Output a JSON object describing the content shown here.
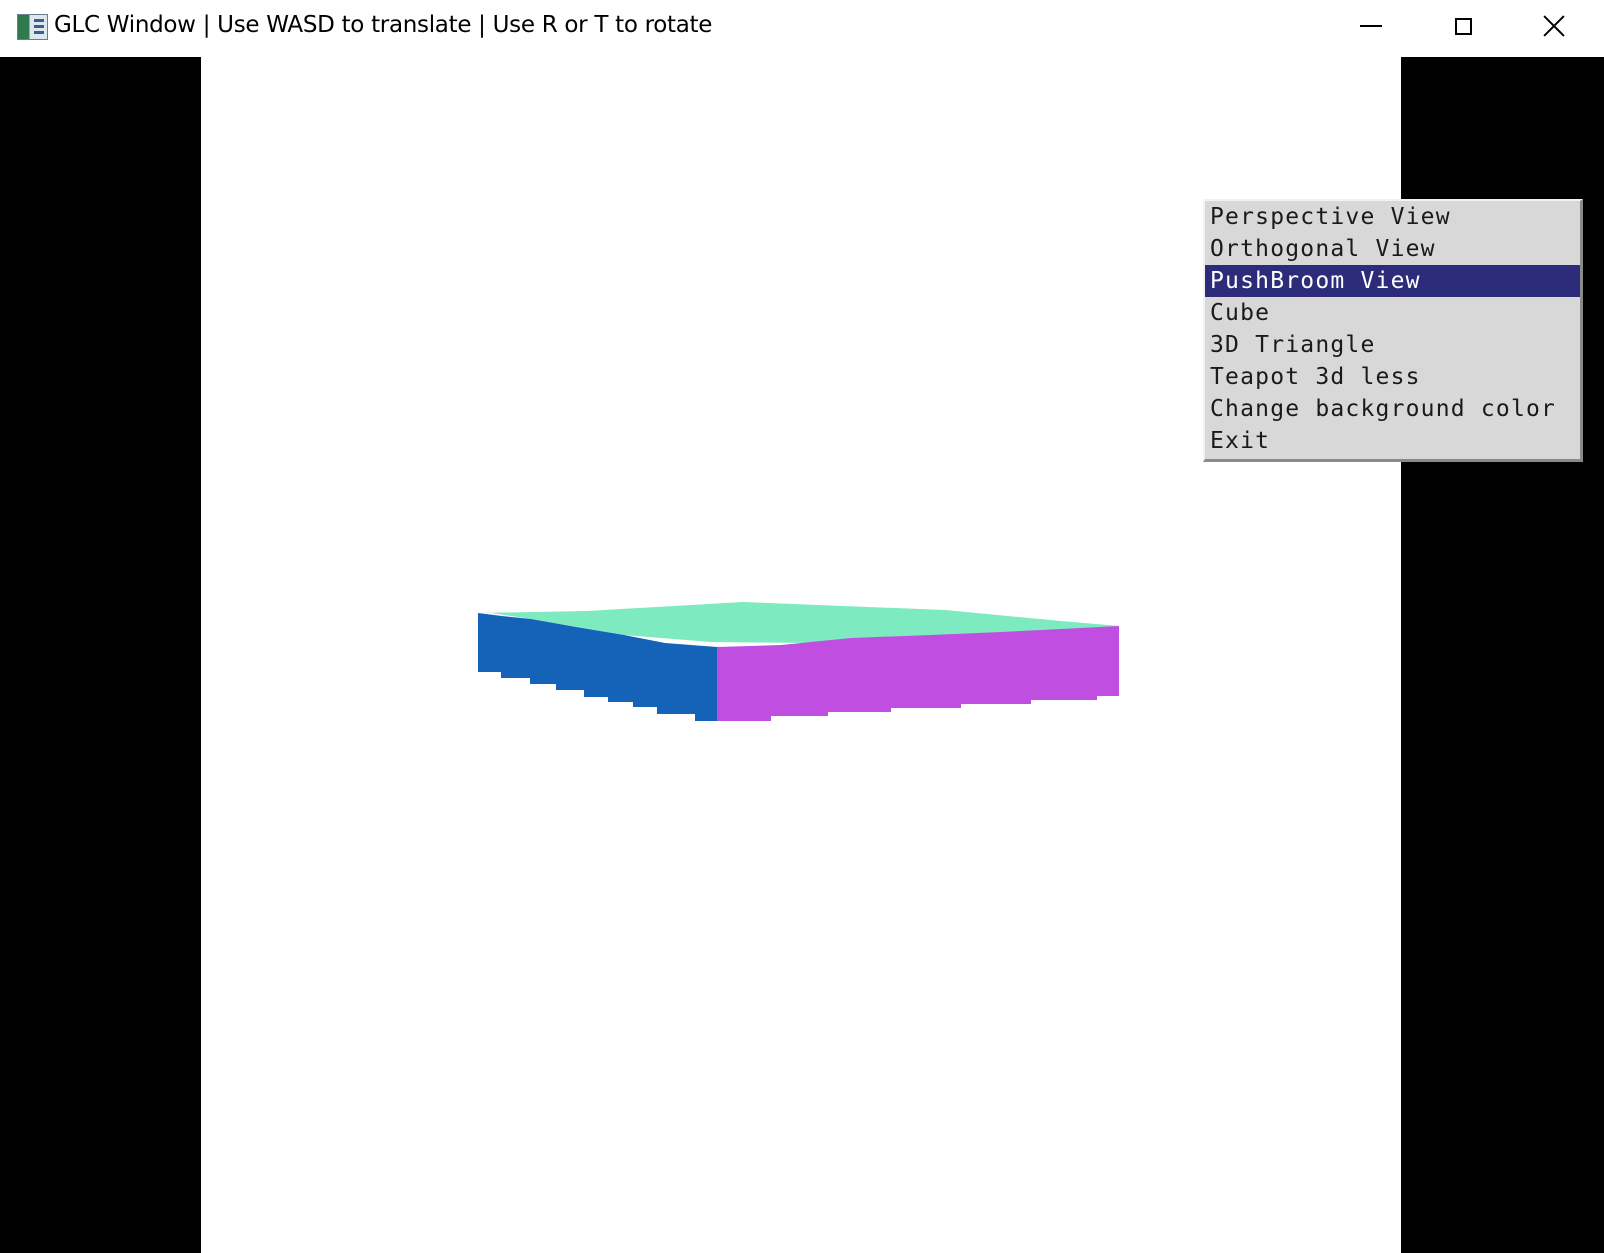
{
  "window": {
    "title": "GLC Window | Use WASD to translate | Use R or T to rotate",
    "icon": "glut-window-icon",
    "controls": {
      "minimize": "minimize-icon",
      "maximize": "maximize-icon",
      "close": "close-icon"
    }
  },
  "viewport": {
    "background_color": "#ffffff",
    "letterbox_color": "#000000"
  },
  "scene": {
    "object": "cube",
    "faces": {
      "top": "#7eeac0",
      "left": "#1563b9",
      "right": "#c04ee0"
    }
  },
  "context_menu": {
    "selected_index": 2,
    "items": [
      "Perspective View",
      "Orthogonal View",
      "PushBroom View",
      "Cube",
      "3D Triangle",
      "Teapot 3d less",
      "Change background color",
      "Exit"
    ]
  }
}
